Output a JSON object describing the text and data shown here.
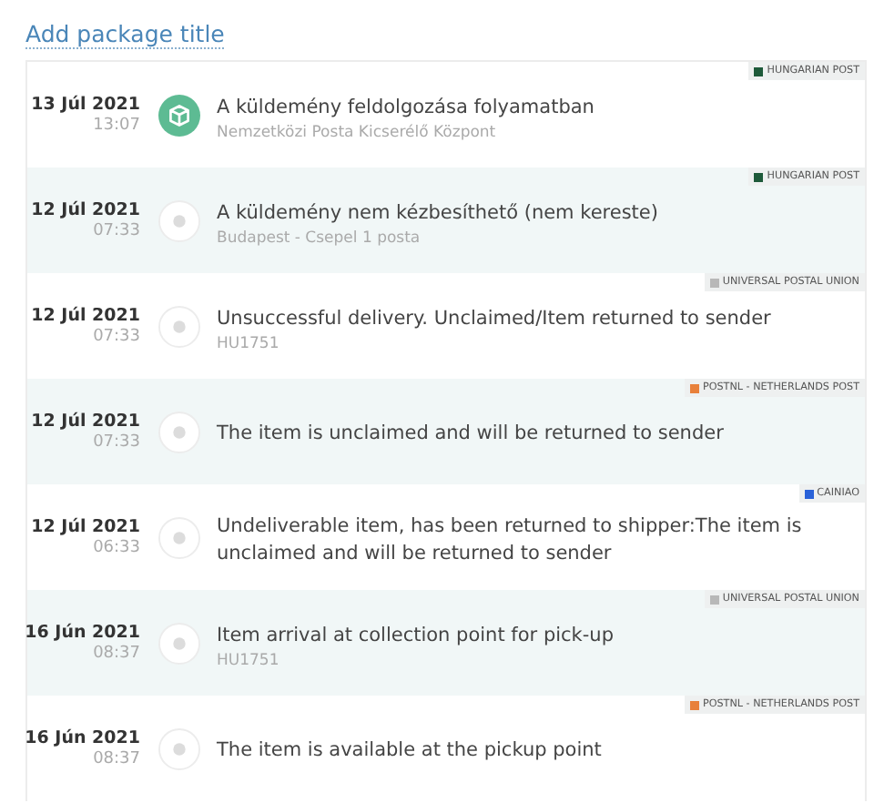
{
  "title_link": "Add package title",
  "events": [
    {
      "date": "13 Júl 2021",
      "time": "13:07",
      "current": true,
      "title": "A küldemény feldolgozása folyamatban",
      "detail": "Nemzetközi Posta Kicserélő Központ",
      "carrier": {
        "name": "HUNGARIAN POST",
        "color": "#1e5a3a"
      }
    },
    {
      "date": "12 Júl 2021",
      "time": "07:33",
      "current": false,
      "title": "A küldemény nem kézbesíthető (nem kereste)",
      "detail": "Budapest - Csepel 1 posta",
      "carrier": {
        "name": "HUNGARIAN POST",
        "color": "#1e5a3a"
      }
    },
    {
      "date": "12 Júl 2021",
      "time": "07:33",
      "current": false,
      "title": "Unsuccessful delivery. Unclaimed/Item returned to sender",
      "detail": "HU1751",
      "carrier": {
        "name": "UNIVERSAL POSTAL UNION",
        "color": "#b8b8b8"
      }
    },
    {
      "date": "12 Júl 2021",
      "time": "07:33",
      "current": false,
      "title": "The item is unclaimed and will be returned to sender",
      "carrier": {
        "name": "POSTNL - NETHERLANDS POST",
        "color": "#e8803a"
      }
    },
    {
      "date": "12 Júl 2021",
      "time": "06:33",
      "current": false,
      "title": "Undeliverable item, has been returned to shipper:The item is unclaimed and will be returned to sender",
      "carrier": {
        "name": "CAINIAO",
        "color": "#2a62d8"
      }
    },
    {
      "date": "16 Jún 2021",
      "time": "08:37",
      "current": false,
      "title": "Item arrival at collection point for pick-up",
      "detail": "HU1751",
      "carrier": {
        "name": "UNIVERSAL POSTAL UNION",
        "color": "#b8b8b8"
      }
    },
    {
      "date": "16 Jún 2021",
      "time": "08:37",
      "current": false,
      "title": "The item is available at the pickup point",
      "carrier": {
        "name": "POSTNL - NETHERLANDS POST",
        "color": "#e8803a"
      }
    }
  ]
}
